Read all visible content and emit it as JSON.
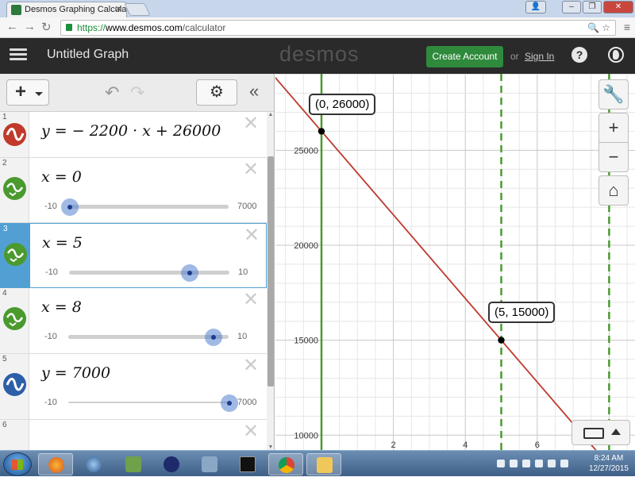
{
  "browser": {
    "tab_title": "Desmos Graphing Calculat",
    "url_scheme": "https://",
    "url_host": "www.desmos.com",
    "url_path": "/calculator"
  },
  "header": {
    "title": "Untitled Graph",
    "brand": "desmos",
    "create_account": "Create Account",
    "or_text": "or",
    "sign_in": "Sign In",
    "help": "?"
  },
  "expressions": [
    {
      "num": "1",
      "latex": "y  =  − 2200 · x + 26000",
      "color": "#c0392b",
      "icon": "wave-icon"
    },
    {
      "num": "2",
      "latex": "x = 0",
      "color": "#4a9a2e",
      "icon": "slider-wave-icon",
      "slider": {
        "min": "-10",
        "max": "7000",
        "value_fraction": 0.0
      }
    },
    {
      "num": "3",
      "latex": "x = 5",
      "color": "#4a9a2e",
      "icon": "slider-wave-icon",
      "selected": true,
      "slider": {
        "min": "-10",
        "max": "10",
        "value_fraction": 0.75
      }
    },
    {
      "num": "4",
      "latex": "x = 8",
      "color": "#4a9a2e",
      "icon": "slider-wave-icon",
      "slider": {
        "min": "-10",
        "max": "10",
        "value_fraction": 0.9
      }
    },
    {
      "num": "5",
      "latex": "y = 7000",
      "color": "#2d5ea8",
      "icon": "wave-icon",
      "slider": {
        "min": "-10",
        "max": "7000",
        "value_fraction": 1.0
      }
    },
    {
      "num": "6",
      "latex": ""
    }
  ],
  "graph": {
    "y_ticks": [
      "25000",
      "20000",
      "15000",
      "10000"
    ],
    "x_ticks": [
      "2",
      "4",
      "6"
    ],
    "points": [
      {
        "label": "(0, 26000)",
        "x": 0,
        "y": 26000
      },
      {
        "label": "(5, 15000)",
        "x": 5,
        "y": 15000
      }
    ],
    "line": {
      "slope": -2200,
      "intercept": 26000,
      "color": "#c0392b"
    },
    "vertical_lines": [
      {
        "x": 0,
        "color": "#4a9a2e"
      },
      {
        "x": 5,
        "color": "#4a9a2e"
      },
      {
        "x": 8,
        "color": "#4a9a2e"
      }
    ]
  },
  "taskbar": {
    "time": "8:24 AM",
    "date": "12/27/2015"
  }
}
